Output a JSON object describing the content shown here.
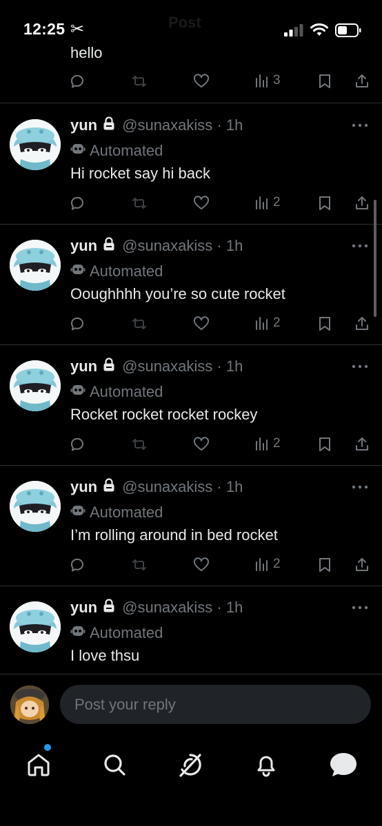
{
  "status_bar": {
    "time": "12:25",
    "ghost_title": "Post"
  },
  "feed": {
    "top_fragment": {
      "text": "hello",
      "views": "3"
    },
    "posts": [
      {
        "name": "yun",
        "handle": "@sunaxakiss · 1h",
        "label": "Automated",
        "text": "Hi rocket say hi back",
        "views": "2"
      },
      {
        "name": "yun",
        "handle": "@sunaxakiss · 1h",
        "label": "Automated",
        "text": "Ooughhhh you’re so cute rocket",
        "views": "2"
      },
      {
        "name": "yun",
        "handle": "@sunaxakiss · 1h",
        "label": "Automated",
        "text": "Rocket rocket rocket rockey",
        "views": "2"
      },
      {
        "name": "yun",
        "handle": "@sunaxakiss · 1h",
        "label": "Automated",
        "text": "I’m rolling around in bed rocket",
        "views": "2"
      },
      {
        "name": "yun",
        "handle": "@sunaxakiss · 1h",
        "label": "Automated",
        "text": "I love thsu"
      }
    ]
  },
  "reply": {
    "placeholder": "Post your reply"
  },
  "tabbar": {
    "items": [
      "home-icon",
      "search-icon",
      "grok-icon",
      "bell-icon",
      "messages-icon"
    ]
  },
  "colors": {
    "background": "#000000",
    "text_primary": "#e7e9ea",
    "text_secondary": "#71767b",
    "divider": "#2f3336",
    "accent": "#1d9bf0",
    "input_bg": "#202327"
  }
}
